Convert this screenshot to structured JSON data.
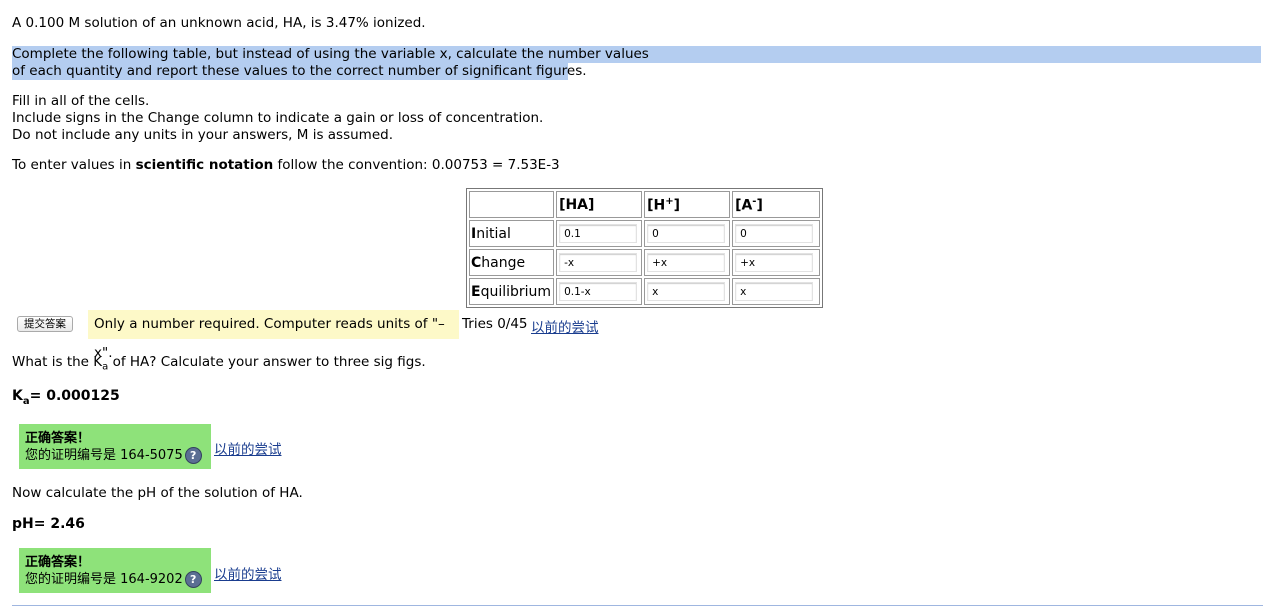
{
  "intro": "A 0.100 M solution of an unknown acid, HA, is 3.47% ionized.",
  "instruction_line1": "Complete the following table, but instead of using the variable x, calculate the number values",
  "instruction_line2": "of each quantity and report these values to the correct number of significant figures.",
  "fill_line": "Fill in all of the cells.",
  "signs_line": "Include signs in the Change column to indicate a gain or loss of concentration.",
  "units_line": "Do not include any units in your answers, M is assumed.",
  "sci_prefix": "To enter values in ",
  "sci_bold": "scientific notation",
  "sci_suffix": " follow the convention: 0.00753 = 7.53E-3",
  "table": {
    "headers": [
      "[HA]",
      "[H",
      "[A"
    ],
    "header_sup": [
      "",
      "+",
      "-"
    ],
    "rows": [
      {
        "cap": "I",
        "rest": "nitial",
        "values": [
          "0.1",
          "0",
          "0"
        ]
      },
      {
        "cap": "C",
        "rest": "hange",
        "values": [
          "-x",
          "+x",
          "+x"
        ]
      },
      {
        "cap": "E",
        "rest": "quilibrium",
        "values": [
          "0.1-x",
          "x",
          "x"
        ]
      }
    ]
  },
  "submit_label": "提交答案",
  "hint_text": "Only a number required. Computer reads units of \"–x\".",
  "tries_text": "Tries 0/45",
  "previous_tries": "以前的尝试",
  "ka_question_pre": "What is the K",
  "ka_sub": "a",
  "ka_question_post": " of HA? Calculate your answer to three sig figs.",
  "ka_label": "K",
  "ka_label_sub": "a",
  "ka_value": "= 0.000125",
  "correct1": {
    "title": "正确答案！",
    "line": "您的证明编号是 164-5075"
  },
  "ph_question": "Now calculate the pH of the solution of HA.",
  "ph_answer": "pH= 2.46",
  "correct2": {
    "title": "正确答案！",
    "line": "您的证明编号是 164-9202"
  },
  "help_glyph": "?"
}
